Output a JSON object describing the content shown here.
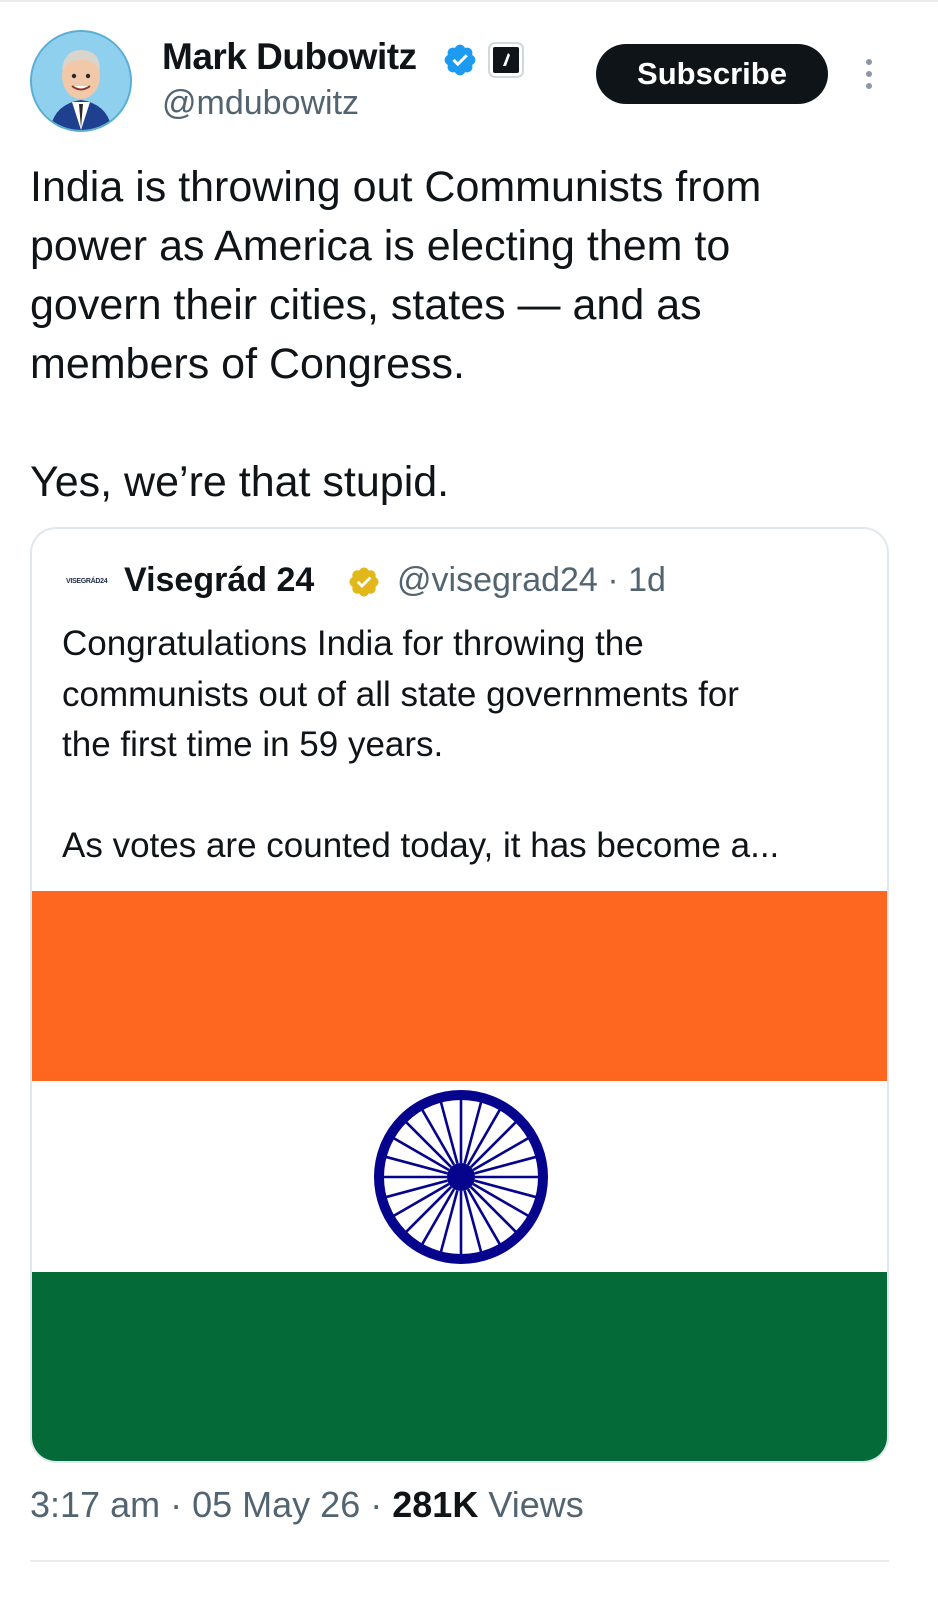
{
  "author": {
    "name": "Mark Dubowitz",
    "handle": "@mdubowitz",
    "subscribe_label": "Subscribe"
  },
  "tweet": {
    "text": "India is throwing out Communists from\npower as America is electing them to\ngovern their cities, states — and as\nmembers of Congress.\n\nYes, we’re that stupid."
  },
  "quoted": {
    "logo_text": "VISEGRÁD24",
    "name": "Visegrád 24",
    "handle": "@visegrad24",
    "separator": "·",
    "age": "1d",
    "text": "Congratulations India for throwing the\ncommunists out of all state governments for\nthe first time in 59 years.\n\nAs votes are counted today, it has become a..."
  },
  "footer": {
    "time": "3:17 am",
    "date": "05 May 26",
    "views_count": "281K",
    "views_label": "Views",
    "sep": "·"
  },
  "colors": {
    "verified_blue": "#1d9bf0",
    "gold_badge": "#e2b719",
    "saffron": "#fe671f",
    "green": "#046a38",
    "chakra_navy": "#06038d"
  },
  "icons": [
    "verified-badge-icon",
    "affiliate-badge-icon",
    "more-options-icon",
    "gold-verified-badge-icon",
    "ashoka-chakra"
  ]
}
